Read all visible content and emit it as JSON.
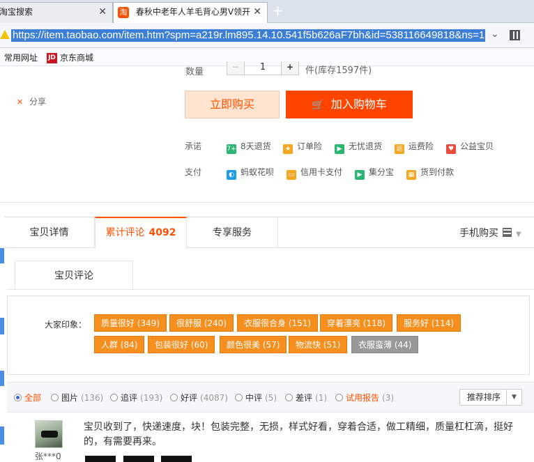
{
  "browser": {
    "tabs": [
      {
        "label": "淘宝搜索",
        "active": false
      },
      {
        "label": "春秋中老年人羊毛背心男V领开",
        "active": true,
        "favicon": "淘"
      }
    ],
    "new_tab": "+",
    "url": "https://item.taobao.com/item.htm?spm=a219r.lm895.14.10.541f5b626aF7bh&id=538116649818&ns=1",
    "bookmarks": [
      {
        "label": "常用网址"
      },
      {
        "label": "京东商城",
        "icon": "JD"
      }
    ]
  },
  "product": {
    "qty_label": "数量",
    "qty_value": "1",
    "qty_minus": "−",
    "qty_plus": "+",
    "stock": "件(库存1597件)",
    "share": "分享",
    "buy_now": "立即购买",
    "add_cart": "加入购物车",
    "promise_label": "承诺",
    "promises": [
      {
        "label": "8天退货",
        "icon_char": "7+",
        "color": "#2bb673"
      },
      {
        "label": "订单险",
        "icon_char": "★",
        "color": "#f5a623"
      },
      {
        "label": "无忧退货",
        "icon_char": "▶",
        "color": "#2bb673"
      },
      {
        "label": "运费险",
        "icon_char": "运",
        "color": "#f5a623"
      },
      {
        "label": "公益宝贝",
        "icon_char": "♥",
        "color": "#e74c3c"
      }
    ],
    "pay_label": "支付",
    "payments": [
      {
        "label": "蚂蚁花呗",
        "icon_char": "◐",
        "color": "#1e9de8"
      },
      {
        "label": "信用卡支付",
        "icon_char": "▭",
        "color": "#f5a623"
      },
      {
        "label": "集分宝",
        "icon_char": "▶",
        "color": "#2bb673"
      },
      {
        "label": "货到付款",
        "icon_char": "▦",
        "color": "#f5a623"
      }
    ]
  },
  "tabs": {
    "detail": "宝贝详情",
    "reviews": "累计评论",
    "reviews_count": "4092",
    "service": "专享服务",
    "mobile_buy": "手机购买"
  },
  "reviews": {
    "subtab": "宝贝评论",
    "impression_label": "大家印象：",
    "tags_row1": [
      {
        "label": "质量很好 (349)",
        "negative": false
      },
      {
        "label": "很舒服 (240)",
        "negative": false
      },
      {
        "label": "衣服很合身 (151)",
        "negative": false
      },
      {
        "label": "穿着漂亮 (118)",
        "negative": false
      },
      {
        "label": "服务好 (114)",
        "negative": false
      }
    ],
    "tags_row2": [
      {
        "label": "人群 (84)",
        "negative": false
      },
      {
        "label": "包装很好 (60)",
        "negative": false
      },
      {
        "label": "颜色很美 (57)",
        "negative": false
      },
      {
        "label": "物流快 (51)",
        "negative": false
      },
      {
        "label": "衣服蛮薄 (44)",
        "negative": true
      }
    ],
    "filters": [
      {
        "label": "全部",
        "count": "",
        "selected": true
      },
      {
        "label": "图片",
        "count": "(136)",
        "selected": false
      },
      {
        "label": "追评",
        "count": "(193)",
        "selected": false
      },
      {
        "label": "好评",
        "count": "(4087)",
        "selected": false
      },
      {
        "label": "中评",
        "count": "(5)",
        "selected": false
      },
      {
        "label": "差评",
        "count": "(1)",
        "selected": false
      },
      {
        "label": "试用报告",
        "count": "(3)",
        "selected": false
      }
    ],
    "sort": "推荐排序",
    "sort_arrow": "▼",
    "item": {
      "user": "张***0",
      "text": "宝贝收到了，快递速度，块！包装完整，无损，样式好看，穿着合适，做工精细，质量杠杠滴，挺好的，有需要再来。"
    }
  }
}
